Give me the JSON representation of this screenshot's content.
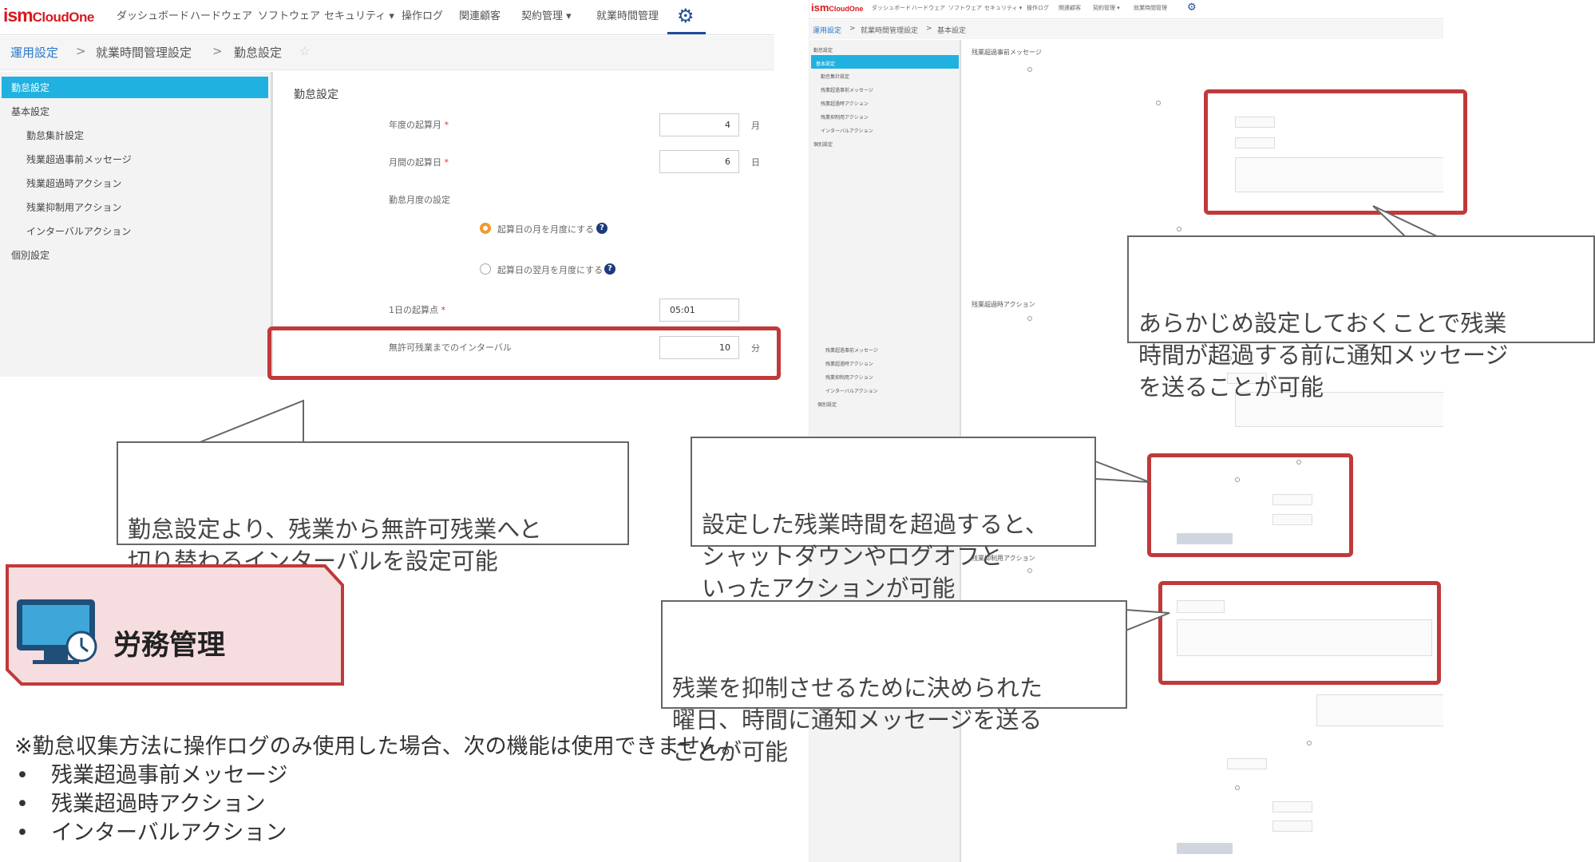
{
  "left_app": {
    "logo_ism": "ism",
    "logo_cloud": "CloudOne",
    "nav": [
      "ダッシュボード",
      "ハードウェア",
      "ソフトウェア",
      "セキュリティ ▾",
      "操作ログ",
      "関連顧客",
      "契約管理 ▾",
      "就業時間管理"
    ],
    "breadcrumb": {
      "root": "運用設定",
      "sep": ">",
      "mid": "就業時間管理設定",
      "current": "勤怠設定"
    },
    "sidebar": [
      "勤怠設定",
      "基本設定",
      "勤怠集計設定",
      "残業超過事前メッセージ",
      "残業超過時アクション",
      "残業抑制用アクション",
      "インターバルアクション",
      "個別設定"
    ],
    "page_title": "勤怠設定",
    "form": {
      "year_start_label": "年度の起算月",
      "year_start_value": "4",
      "year_start_unit": "月",
      "month_start_label": "月間の起算日",
      "month_start_value": "6",
      "month_start_unit": "日",
      "month_setting_label": "勤怠月度の設定",
      "radio1": "起算日の月を月度にする",
      "radio2": "起算日の翌月を月度にする",
      "day_start_label": "1日の起算点",
      "day_start_value": "05:01",
      "interval_label": "無許可残業までのインターバル",
      "interval_value": "10",
      "interval_unit": "分",
      "req": "*"
    }
  },
  "right_app": {
    "logo_ism": "ism",
    "logo_cloud": "CloudOne",
    "nav": [
      "ダッシュボード",
      "ハードウェア",
      "ソフトウェア",
      "セキュリティ ▾",
      "操作ログ",
      "関連顧客",
      "契約管理 ▾",
      "就業時間管理"
    ],
    "breadcrumb": {
      "root": "運用設定",
      "sep": ">",
      "mid": "就業時間管理設定",
      "current": "基本設定"
    },
    "sidebar": [
      "勤怠設定",
      "基本設定",
      "勤怠集計設定",
      "残業超過事前メッセージ",
      "残業超過時アクション",
      "残業抑制用アクション",
      "インターバルアクション",
      "個別設定"
    ],
    "sections": [
      "残業超過事前メッセージ",
      "残業超過時アクション",
      "残業抑制用アクション"
    ],
    "sidebar2": [
      "残業超過事前メッセージ",
      "残業超過時アクション",
      "残業抑制用アクション",
      "インターバルアクション",
      "個別設定"
    ]
  },
  "callouts": {
    "interval": [
      "勤怠設定より、残業から無許可残業へと",
      "切り替わるインターバルを設定可能"
    ],
    "premessage": [
      "あらかじめ設定しておくことで残業",
      "時間が超過する前に通知メッセージ",
      "を送ることが可能"
    ],
    "action": [
      "設定した残業時間を超過すると、",
      "シャットダウンやログオフと",
      "いったアクションが可能"
    ],
    "suppress": [
      "残業を抑制させるために決められた",
      "曜日、時間に通知メッセージを送る",
      "ことが可能"
    ]
  },
  "badge": {
    "label": "労務管理",
    "icon": "monitor-clock-icon"
  },
  "note": {
    "text": "※勤怠収集方法に操作ログのみ使用した場合、次の機能は使用できません。",
    "bullet": "•",
    "items": [
      "残業超過事前メッセージ",
      "残業超過時アクション",
      "インターバルアクション"
    ]
  },
  "colors": {
    "highlight": "#c0393b",
    "accent": "#21b1e0",
    "badge_fill": "#f6dde0",
    "link": "#2a78c9"
  }
}
